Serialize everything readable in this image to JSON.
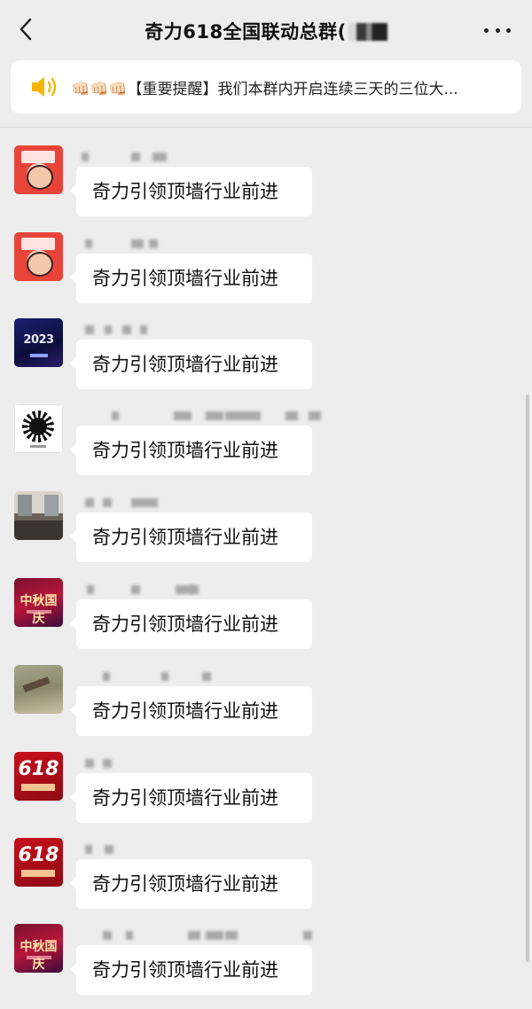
{
  "header": {
    "title": "奇力618全国联动总群(",
    "back_icon": "chevron-left-icon",
    "more_icon": "more-dots-icon"
  },
  "notice": {
    "icon": "speaker-icon",
    "text": "👊🏻👊🏻👊🏻【重要提醒】我们本群内开启连续三天的三位大..."
  },
  "messages": [
    {
      "avatar_style": "red-cartoon",
      "avatar_text": "",
      "text": "奇力引领顶墙行业前进"
    },
    {
      "avatar_style": "red-cartoon",
      "avatar_text": "",
      "text": "奇力引领顶墙行业前进"
    },
    {
      "avatar_style": "navy-2023",
      "avatar_text": "2023",
      "text": "奇力引领顶墙行业前进"
    },
    {
      "avatar_style": "qr-circle",
      "avatar_text": "",
      "text": "奇力引领顶墙行业前进"
    },
    {
      "avatar_style": "room-photo",
      "avatar_text": "",
      "text": "奇力引领顶墙行业前进"
    },
    {
      "avatar_style": "mid-autumn",
      "avatar_text": "中秋国庆",
      "text": "奇力引领顶墙行业前进"
    },
    {
      "avatar_style": "field-photo",
      "avatar_text": "",
      "text": "奇力引领顶墙行业前进"
    },
    {
      "avatar_style": "red-618",
      "avatar_text": "618",
      "text": "奇力引领顶墙行业前进"
    },
    {
      "avatar_style": "red-618",
      "avatar_text": "618",
      "text": "奇力引领顶墙行业前进"
    },
    {
      "avatar_style": "mid-autumn",
      "avatar_text": "中秋国庆",
      "text": "奇力引领顶墙行业前进"
    }
  ],
  "colors": {
    "background": "#ededed",
    "bubble": "#ffffff",
    "speaker": "#f5b400"
  }
}
